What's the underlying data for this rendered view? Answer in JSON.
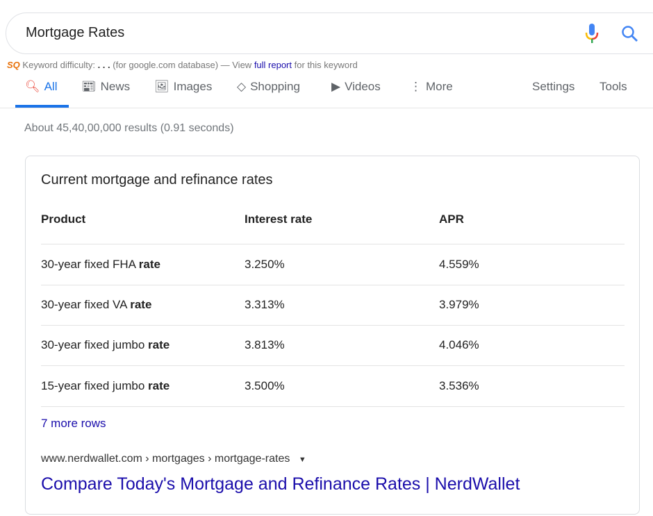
{
  "search": {
    "query": "Mortgage Rates"
  },
  "keyword": {
    "prefix": "Keyword difficulty:",
    "dots": ". . .",
    "middle": "(for google.com database) — View",
    "link": "full report",
    "suffix": "for this keyword",
    "badge": "SQ"
  },
  "tabs": [
    {
      "label": "All",
      "icon": "search-icon"
    },
    {
      "label": "News",
      "icon": "news-icon"
    },
    {
      "label": "Images",
      "icon": "image-icon"
    },
    {
      "label": "Shopping",
      "icon": "tag-icon"
    },
    {
      "label": "Videos",
      "icon": "play-icon"
    },
    {
      "label": "More",
      "icon": "more-vert-icon"
    }
  ],
  "tools": {
    "settings": "Settings",
    "tools": "Tools"
  },
  "stats": "About 45,40,00,000 results (0.91 seconds)",
  "card": {
    "title": "Current mortgage and refinance rates",
    "headers": [
      "Product",
      "Interest rate",
      "APR"
    ],
    "rows": [
      {
        "product": "30-year fixed FHA",
        "bold": "rate",
        "rate": "3.250%",
        "apr": "4.559%"
      },
      {
        "product": "30-year fixed VA",
        "bold": "rate",
        "rate": "3.313%",
        "apr": "3.979%"
      },
      {
        "product": "30-year fixed jumbo",
        "bold": "rate",
        "rate": "3.813%",
        "apr": "4.046%"
      },
      {
        "product": "15-year fixed jumbo",
        "bold": "rate",
        "rate": "3.500%",
        "apr": "3.536%"
      }
    ],
    "more_rows": "7 more rows",
    "url": "www.nerdwallet.com › mortgages › mortgage-rates",
    "link": "Compare Today's Mortgage and Refinance Rates | NerdWallet"
  }
}
